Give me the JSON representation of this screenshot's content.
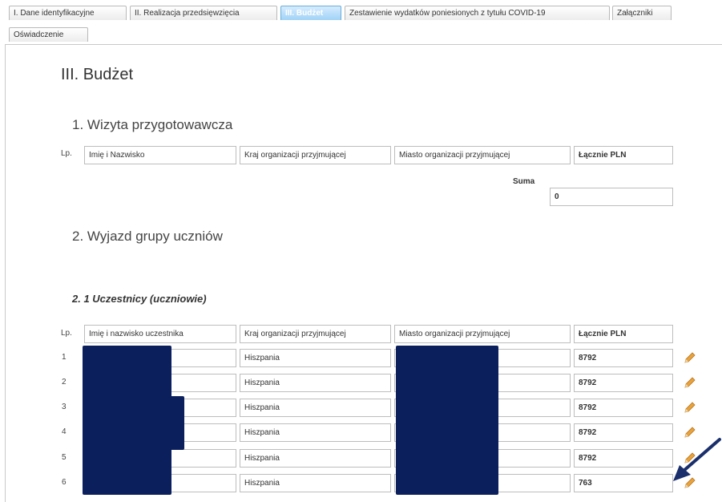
{
  "tabs": [
    {
      "label": "I. Dane identyfikacyjne"
    },
    {
      "label": "II. Realizacja przedsięwzięcia"
    },
    {
      "label": "III. Budżet"
    },
    {
      "label": "Zestawienie wydatków poniesionych z tytułu COVID-19"
    },
    {
      "label": "Załączniki"
    },
    {
      "label": "Oświadczenie"
    }
  ],
  "page_title": "III. Budżet",
  "section1": {
    "title": "1. Wizyta przygotowawcza",
    "lp": "Lp.",
    "headers": [
      "Imię i Nazwisko",
      "Kraj organizacji przyjmującej",
      "Miasto organizacji przyjmującej",
      "Łącznie PLN"
    ],
    "suma_label": "Suma",
    "suma_value": "0"
  },
  "section2": {
    "title": "2. Wyjazd grupy uczniów",
    "subtitle": "2. 1 Uczestnicy (uczniowie)",
    "lp": "Lp.",
    "headers": [
      "Imię i nazwisko uczestnika",
      "Kraj organizacji przyjmującej",
      "Miasto organizacji przyjmującej",
      "Łącznie PLN"
    ],
    "rows": [
      {
        "lp": "1",
        "kraj": "Hiszpania",
        "total": "8792"
      },
      {
        "lp": "2",
        "kraj": "Hiszpania",
        "total": "8792"
      },
      {
        "lp": "3",
        "kraj": "Hiszpania",
        "total": "8792"
      },
      {
        "lp": "4",
        "kraj": "Hiszpania",
        "total": "8792"
      },
      {
        "lp": "5",
        "kraj": "Hiszpania",
        "total": "8792"
      },
      {
        "lp": "6",
        "kraj": "Hiszpania",
        "total": "763"
      }
    ]
  },
  "icons": {
    "edit": "pencil-icon",
    "annotation": "arrow-icon"
  },
  "colors": {
    "active_tab": "#9fd2f6",
    "redaction": "#0a1f5c",
    "arrow": "#1a2f6b",
    "pencil": "#e8a33c"
  }
}
